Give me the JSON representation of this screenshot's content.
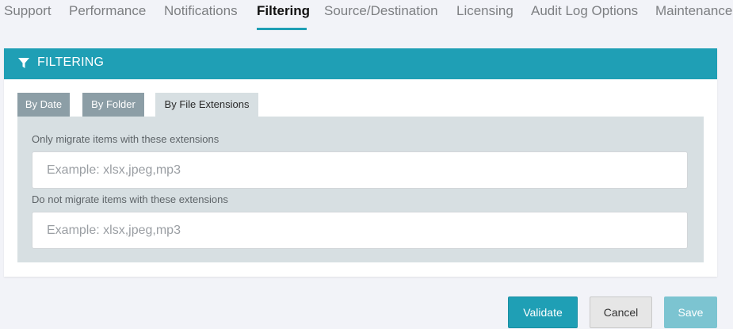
{
  "nav": {
    "tabs": [
      {
        "label": "Support"
      },
      {
        "label": "Performance"
      },
      {
        "label": "Notifications"
      },
      {
        "label": "Filtering"
      },
      {
        "label": "Source/Destination"
      },
      {
        "label": "Licensing"
      },
      {
        "label": "Audit Log Options"
      },
      {
        "label": "Maintenance"
      }
    ],
    "active_tab": "Filtering"
  },
  "panel": {
    "title": "FILTERING",
    "icon": "filter-icon",
    "subtabs": [
      {
        "label": "By Date"
      },
      {
        "label": "By Folder"
      },
      {
        "label": "By File Extensions"
      }
    ],
    "active_subtab": "By File Extensions",
    "include": {
      "label": "Only migrate items with these extensions",
      "placeholder": "Example: xlsx,jpeg,mp3",
      "value": ""
    },
    "exclude": {
      "label": "Do not migrate items with these extensions",
      "placeholder": "Example: xlsx,jpeg,mp3",
      "value": ""
    }
  },
  "actions": {
    "validate_label": "Validate",
    "cancel_label": "Cancel",
    "save_label": "Save"
  },
  "colors": {
    "accent": "#1f9fb5",
    "subtab_inactive": "#8c9ea6",
    "subtab_active": "#d7dfe2",
    "save_disabled": "#7cc4d1"
  }
}
